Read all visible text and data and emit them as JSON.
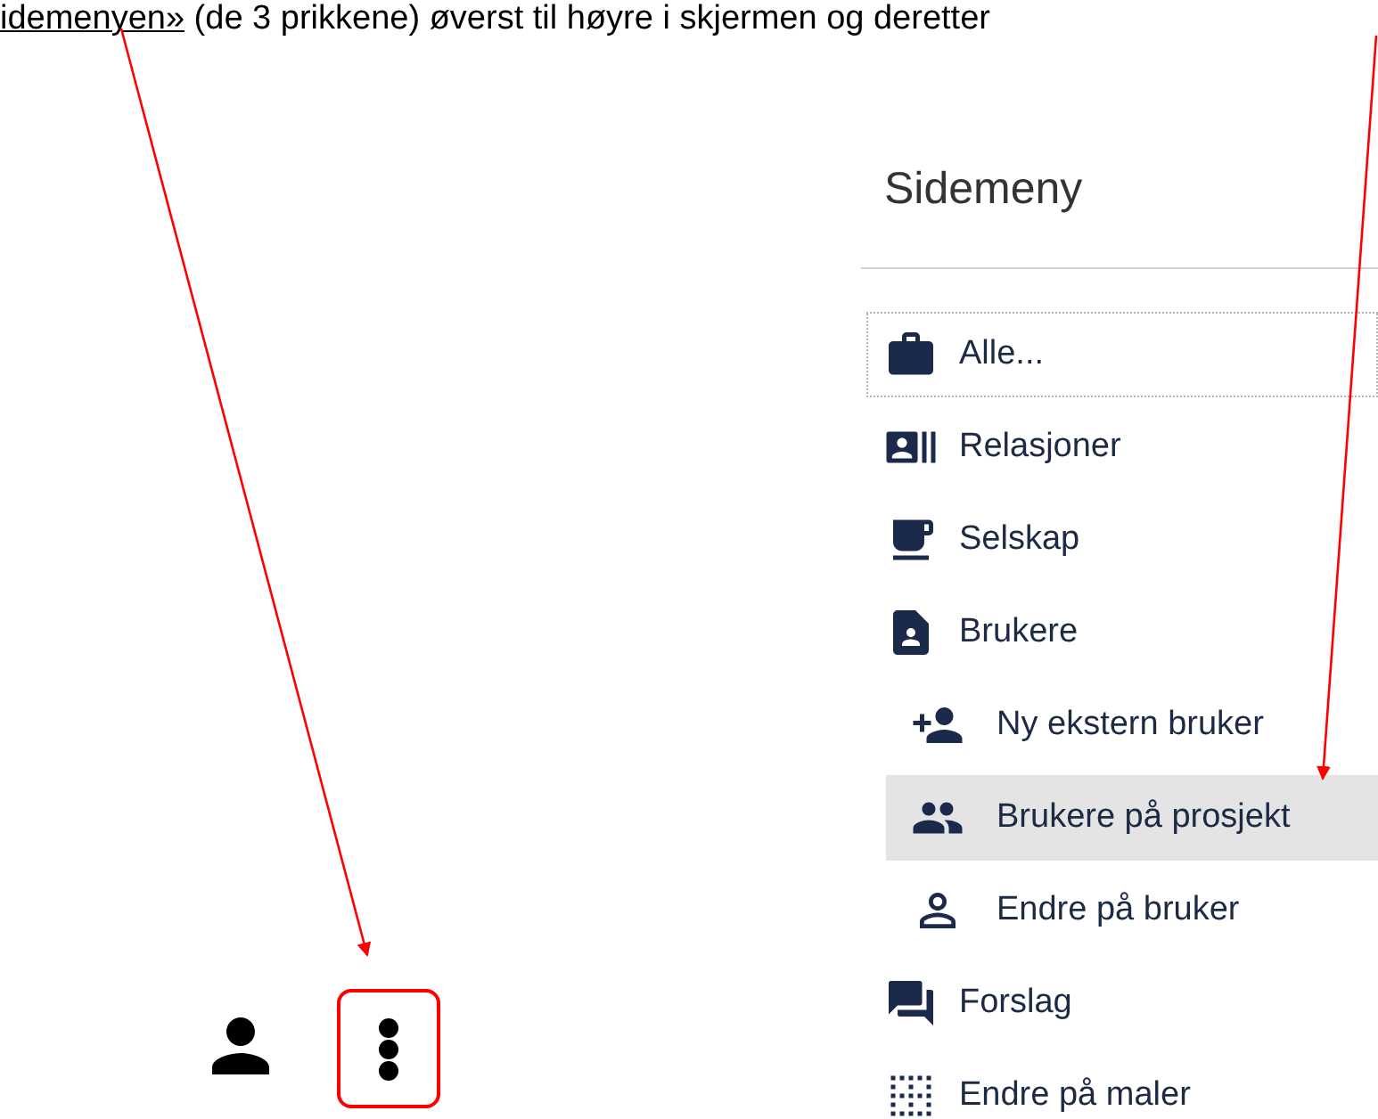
{
  "instruction": {
    "link": "idemenyen»",
    "rest": " (de 3 prikkene) øverst til høyre i skjermen og deretter"
  },
  "sidemenu": {
    "title": "Sidemeny",
    "items": [
      {
        "label": "Alle...",
        "kind": "item",
        "selected": false,
        "focused": true
      },
      {
        "label": "Relasjoner",
        "kind": "item",
        "selected": false,
        "focused": false
      },
      {
        "label": "Selskap",
        "kind": "item",
        "selected": false,
        "focused": false
      },
      {
        "label": "Brukere",
        "kind": "item",
        "selected": false,
        "focused": false
      },
      {
        "label": "Ny ekstern bruker",
        "kind": "subitem",
        "selected": false,
        "focused": false
      },
      {
        "label": "Brukere på prosjekt",
        "kind": "subitem",
        "selected": true,
        "focused": false
      },
      {
        "label": "Endre på bruker",
        "kind": "subitem",
        "selected": false,
        "focused": false
      },
      {
        "label": "Forslag",
        "kind": "item",
        "selected": false,
        "focused": false
      },
      {
        "label": "Endre på maler",
        "kind": "item",
        "selected": false,
        "focused": false
      }
    ]
  },
  "toolbar": {
    "menu_highlighted": true
  }
}
